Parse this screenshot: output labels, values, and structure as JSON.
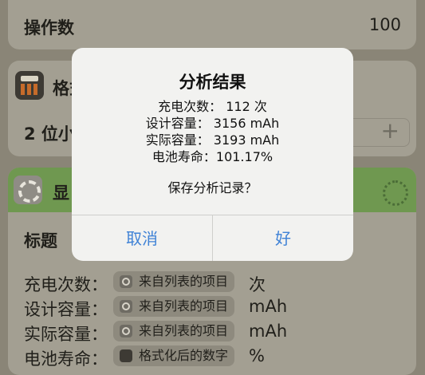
{
  "shortcut": {
    "operand": {
      "label": "操作数",
      "value": "100"
    },
    "format_action": {
      "title_partial": "格式",
      "row_label_partial": "2 位小"
    },
    "show_action": {
      "title_partial": "显",
      "title_field_label": "标题"
    },
    "fields": [
      {
        "label": "充电次数：",
        "token": "来自列表的项目",
        "token_icon": "gear-icon",
        "suffix": "次"
      },
      {
        "label": "设计容量：",
        "token": "来自列表的项目",
        "token_icon": "gear-icon",
        "suffix": "mAh"
      },
      {
        "label": "实际容量：",
        "token": "来自列表的项目",
        "token_icon": "gear-icon",
        "suffix": "mAh"
      },
      {
        "label": "电池寿命：",
        "token": "格式化后的数字",
        "token_icon": "calculator-icon",
        "suffix": "%"
      }
    ],
    "stepper_plus": "+"
  },
  "dialog": {
    "title": "分析结果",
    "lines": [
      "充电次数： 112 次",
      "设计容量： 3156 mAh",
      "实际容量： 3193 mAh",
      "电池寿命：101.17%"
    ],
    "question": "保存分析记录？",
    "cancel_label": "取消",
    "ok_label": "好",
    "button_color": "#3f82d6"
  }
}
